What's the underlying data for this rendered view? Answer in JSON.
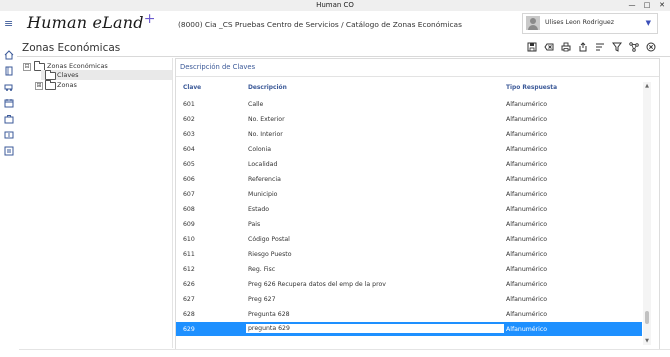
{
  "window": {
    "title": "Human CO",
    "minimize": "—",
    "maximize": "□",
    "close": "✕"
  },
  "header": {
    "menu_icon": "hamburger-icon",
    "logo": "Human eLand",
    "logo_plus": "+",
    "breadcrumb": "(8000) Cia _CS  Pruebas Centro de Servicios /  Catálogo de Zonas Económicas",
    "user_name": "Ulises Leon Rodriguez",
    "user_menu_icon": "triangle-down-icon"
  },
  "page": {
    "title": "Zonas Económicas"
  },
  "toolbar": [
    "save-icon",
    "clear-icon",
    "print-icon",
    "export-icon",
    "sort-icon",
    "filter-icon",
    "share-icon",
    "close-circle-icon"
  ],
  "leftnav": [
    "home-icon",
    "book-icon",
    "car-icon",
    "calendar-icon",
    "briefcase-icon",
    "dollar-icon",
    "id-card-icon"
  ],
  "tree": {
    "root": "Zonas Económicas",
    "root_expander": "⊟",
    "children": [
      {
        "label": "Claves",
        "selected": true
      },
      {
        "label": "Zonas",
        "expander": "⊞"
      }
    ]
  },
  "panel": {
    "title": "Descripción de Claves",
    "columns": [
      "Clave",
      "Descripción",
      "Tipo Respuesta"
    ],
    "rows": [
      {
        "clave": "601",
        "descripcion": "Calle",
        "tipo": "Alfanumérico"
      },
      {
        "clave": "602",
        "descripcion": "No. Exterior",
        "tipo": "Alfanumérico"
      },
      {
        "clave": "603",
        "descripcion": "No. Interior",
        "tipo": "Alfanumérico"
      },
      {
        "clave": "604",
        "descripcion": "Colonia",
        "tipo": "Alfanumérico"
      },
      {
        "clave": "605",
        "descripcion": "Localidad",
        "tipo": "Alfanumérico"
      },
      {
        "clave": "606",
        "descripcion": "Referencia",
        "tipo": "Alfanumérico"
      },
      {
        "clave": "607",
        "descripcion": "Municipio",
        "tipo": "Alfanumérico"
      },
      {
        "clave": "608",
        "descripcion": "Estado",
        "tipo": "Alfanumérico"
      },
      {
        "clave": "609",
        "descripcion": "Pais",
        "tipo": "Alfanumérico"
      },
      {
        "clave": "610",
        "descripcion": "Código Postal",
        "tipo": "Alfanumérico"
      },
      {
        "clave": "611",
        "descripcion": "Riesgo Puesto",
        "tipo": "Alfanumérico"
      },
      {
        "clave": "612",
        "descripcion": "Reg. Fisc",
        "tipo": "Alfanumérico"
      },
      {
        "clave": "626",
        "descripcion": "Preg 626 Recupera datos del emp de la prov",
        "tipo": "Alfanumérico"
      },
      {
        "clave": "627",
        "descripcion": "Preg 627",
        "tipo": "Alfanumérico"
      },
      {
        "clave": "628",
        "descripcion": "Pregunta 628",
        "tipo": "Alfanumérico"
      }
    ],
    "selected_row": {
      "clave": "629",
      "descripcion": "pregunta 629",
      "tipo": "Alfanumérico"
    },
    "scroll_up": "▲",
    "scroll_down": "▼"
  },
  "colors": {
    "accent": "#3b5998",
    "selection": "#1e90ff"
  }
}
